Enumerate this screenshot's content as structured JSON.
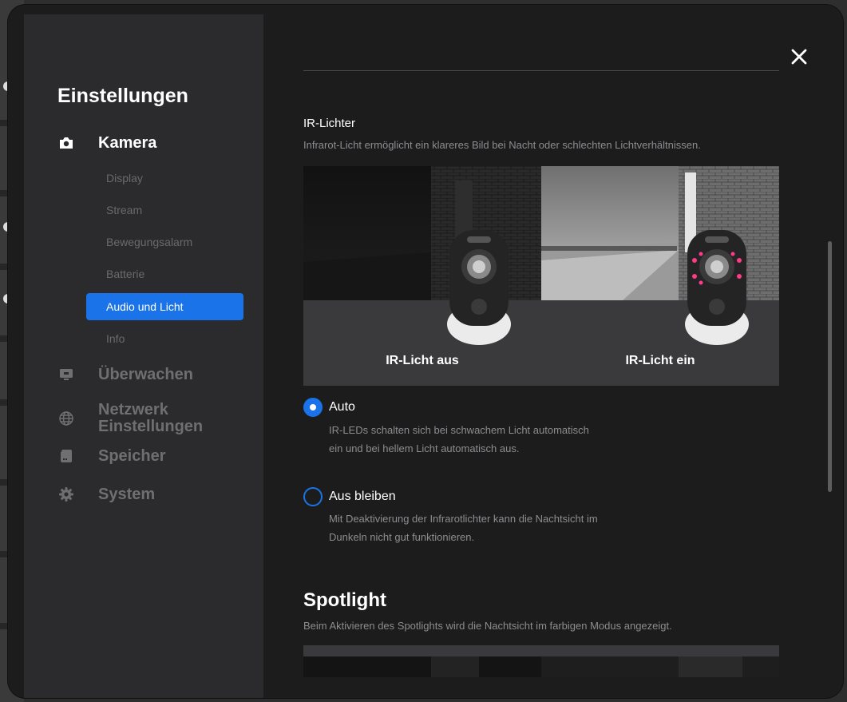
{
  "sidebar": {
    "title": "Einstellungen",
    "sections": [
      {
        "label": "Kamera",
        "icon": "camera-icon",
        "active": true
      },
      {
        "label": "Überwachen",
        "icon": "monitor-icon"
      },
      {
        "label": "Netzwerk Einstellungen",
        "icon": "globe-icon"
      },
      {
        "label": "Speicher",
        "icon": "sd-card-icon"
      },
      {
        "label": "System",
        "icon": "gear-icon"
      }
    ],
    "camera_items": [
      {
        "label": "Display"
      },
      {
        "label": "Stream"
      },
      {
        "label": "Bewegungsalarm"
      },
      {
        "label": "Batterie"
      },
      {
        "label": "Audio und Licht",
        "active": true
      },
      {
        "label": "Info"
      }
    ]
  },
  "ir": {
    "title": "IR-Lichter",
    "description": "Infrarot-Licht ermöglicht ein klareres Bild bei Nacht oder schlechten Lichtverhältnissen.",
    "caption_off": "IR-Licht aus",
    "caption_on": "IR-Licht ein",
    "options": [
      {
        "label": "Auto",
        "selected": true,
        "description": "IR-LEDs schalten sich bei schwachem Licht automatisch ein und bei hellem Licht automatisch aus."
      },
      {
        "label": "Aus bleiben",
        "selected": false,
        "description": "Mit Deaktivierung der Infrarotlichter kann die Nachtsicht im Dunkeln nicht gut funktionieren."
      }
    ]
  },
  "spotlight": {
    "title": "Spotlight",
    "description": "Beim Aktivieren des Spotlights wird die Nachtsicht im farbigen Modus angezeigt."
  },
  "colors": {
    "accent": "#1a73e8",
    "panel": "#1c1c1d",
    "sidebar": "#2b2b2d",
    "ir_led": "#ff3b8a"
  }
}
